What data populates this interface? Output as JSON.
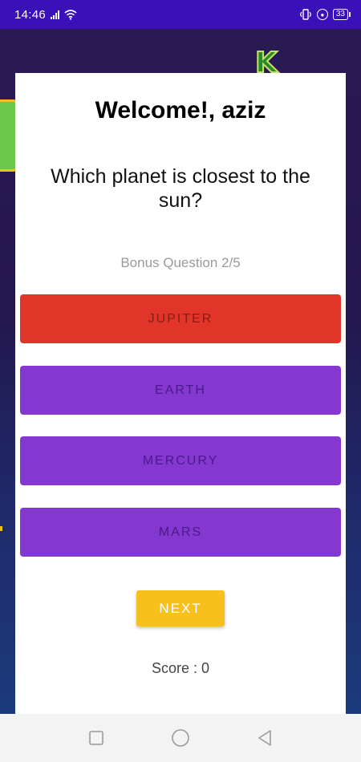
{
  "status_bar": {
    "time": "14:46",
    "battery": "33"
  },
  "quiz": {
    "welcome": "Welcome!, aziz",
    "question": "Which planet is closest to the sun?",
    "bonus_label": "Bonus Question 2/5",
    "options": [
      {
        "label": "JUPITER",
        "color": "#e03528",
        "state": "selected-wrong"
      },
      {
        "label": "EARTH",
        "color": "#8438d0"
      },
      {
        "label": "MERCURY",
        "color": "#8438d0"
      },
      {
        "label": "MARS",
        "color": "#8438d0"
      }
    ],
    "next_label": "NEXT",
    "score_text": "Score : 0"
  },
  "colors": {
    "status_bar": "#3a10b8",
    "option_default": "#8438d0",
    "option_wrong": "#e03528",
    "next_button": "#f7c01d"
  },
  "icons": {
    "nav_recent": "square-icon",
    "nav_home": "circle-icon",
    "nav_back": "triangle-back-icon"
  }
}
